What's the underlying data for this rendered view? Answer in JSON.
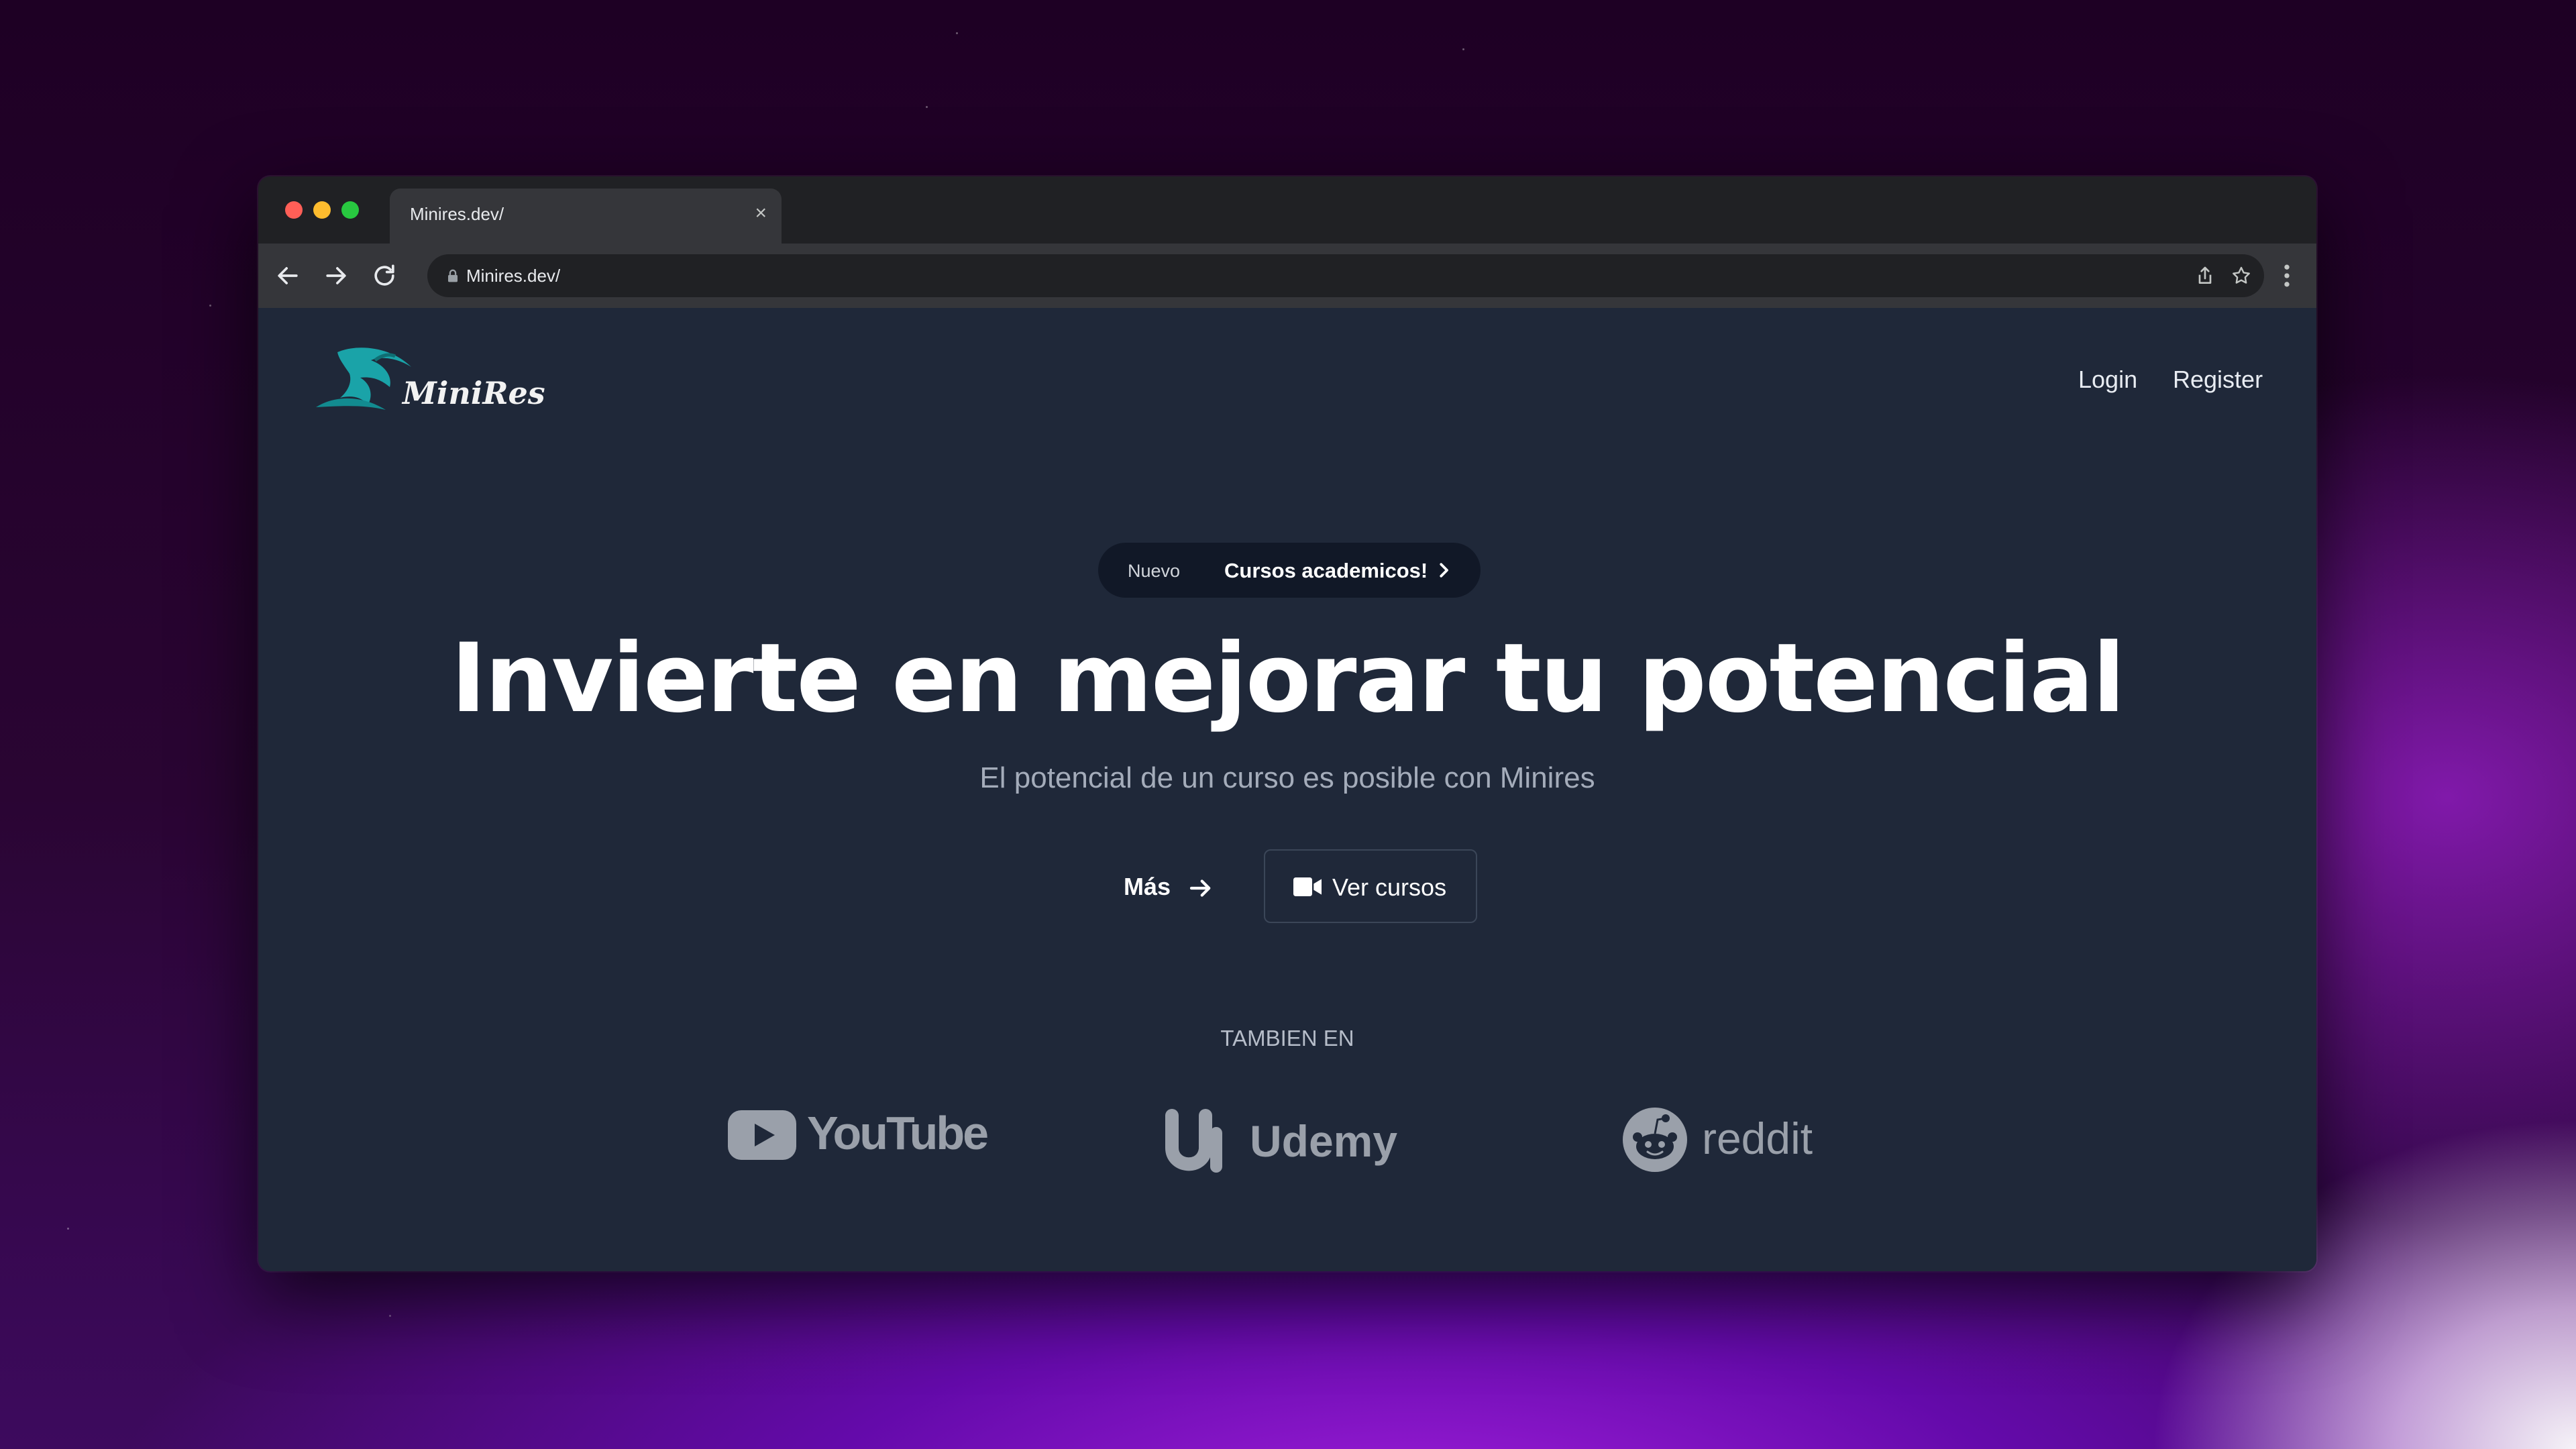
{
  "browser": {
    "tab_title": "Minires.dev/",
    "url": "Minires.dev/"
  },
  "site": {
    "logo_text": "MiniRes",
    "nav": {
      "login": "Login",
      "register": "Register"
    },
    "badge": {
      "tag": "Nuevo",
      "text": "Cursos academicos!"
    },
    "headline": "Invierte en mejorar tu potencial",
    "subtitle": "El potencial de un curso es posible con Minires",
    "buttons": {
      "more": "Más",
      "courses": "Ver cursos"
    },
    "also_label": "TAMBIEN EN",
    "platforms": [
      "YouTube",
      "Udemy",
      "reddit"
    ]
  },
  "colors": {
    "page_bg": "#1f2839",
    "badge_bg": "#111827",
    "logo_accent": "#1aa3a8",
    "traffic_red": "#ff5f57",
    "traffic_yellow": "#febc2e",
    "traffic_green": "#28c840"
  }
}
